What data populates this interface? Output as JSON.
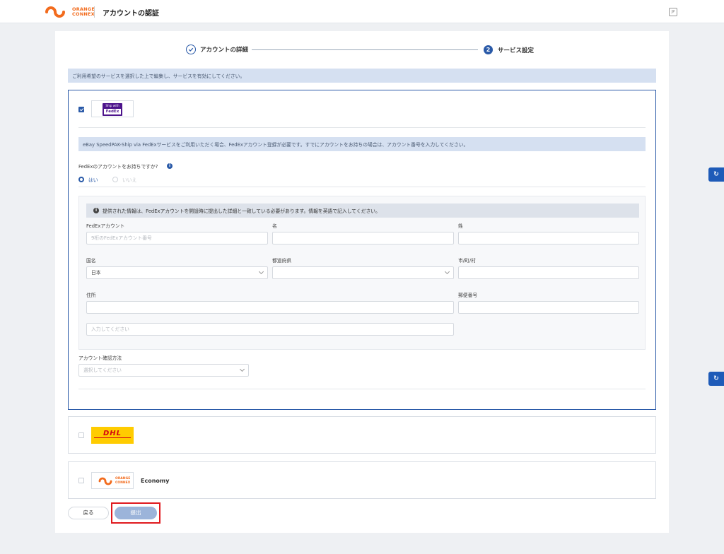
{
  "header": {
    "logo_line1": "ORANGE",
    "logo_line2": "CONNEX",
    "title": "アカウントの認証",
    "lang_icon": "JP"
  },
  "stepper": {
    "step1_label": "アカウントの詳細",
    "step2_number": "2",
    "step2_label": "サービス設定"
  },
  "notice": "ご利用希望のサービスを選択した上で編集し、サービスを有効にしてください。",
  "fedex_panel": {
    "checked": true,
    "logo_line1": "Ship with",
    "logo_line2": "FedEx",
    "notice": "eBay SpeedPAK-Ship via FedExサービスをご利用いただく場合、FedExアカウント登録が必要です。すでにアカウントをお持ちの場合は、アカウント番号を入力してください。",
    "question": "FedExのアカウントをお持ちですか?",
    "radio_yes": "はい",
    "radio_no": "いいえ",
    "inner_notice": "提供された情報は、FedExアカウントを開設時に提出した詳細と一致している必要があります。情報を英語で記入してください。",
    "fields": {
      "account_label": "FedExアカウント",
      "account_placeholder": "9桁のFedExアカウント番号",
      "first_name_label": "名",
      "last_name_label": "姓",
      "country_label": "国名",
      "country_value": "日本",
      "prefecture_label": "都道府県",
      "city_label": "市/町/村",
      "address_label": "住所",
      "address2_placeholder": "入力してください",
      "postal_label": "郵便番号"
    },
    "verify_label": "アカウント確認方法",
    "verify_placeholder": "選択してください"
  },
  "dhl_panel": {
    "checked": false,
    "logo_text": "DHL"
  },
  "oc_panel": {
    "checked": false,
    "logo_line1": "ORANGE",
    "logo_line2": "CONNEX",
    "service_name": "Economy"
  },
  "actions": {
    "back_label": "戻る",
    "submit_label": "提出"
  },
  "colors": {
    "primary": "#2a5aa8",
    "brand_orange": "#f26b1d",
    "dhl_yellow": "#ffcc00",
    "dhl_red": "#d40511",
    "fedex_purple": "#4d148c",
    "highlight_red": "#e0191e"
  }
}
